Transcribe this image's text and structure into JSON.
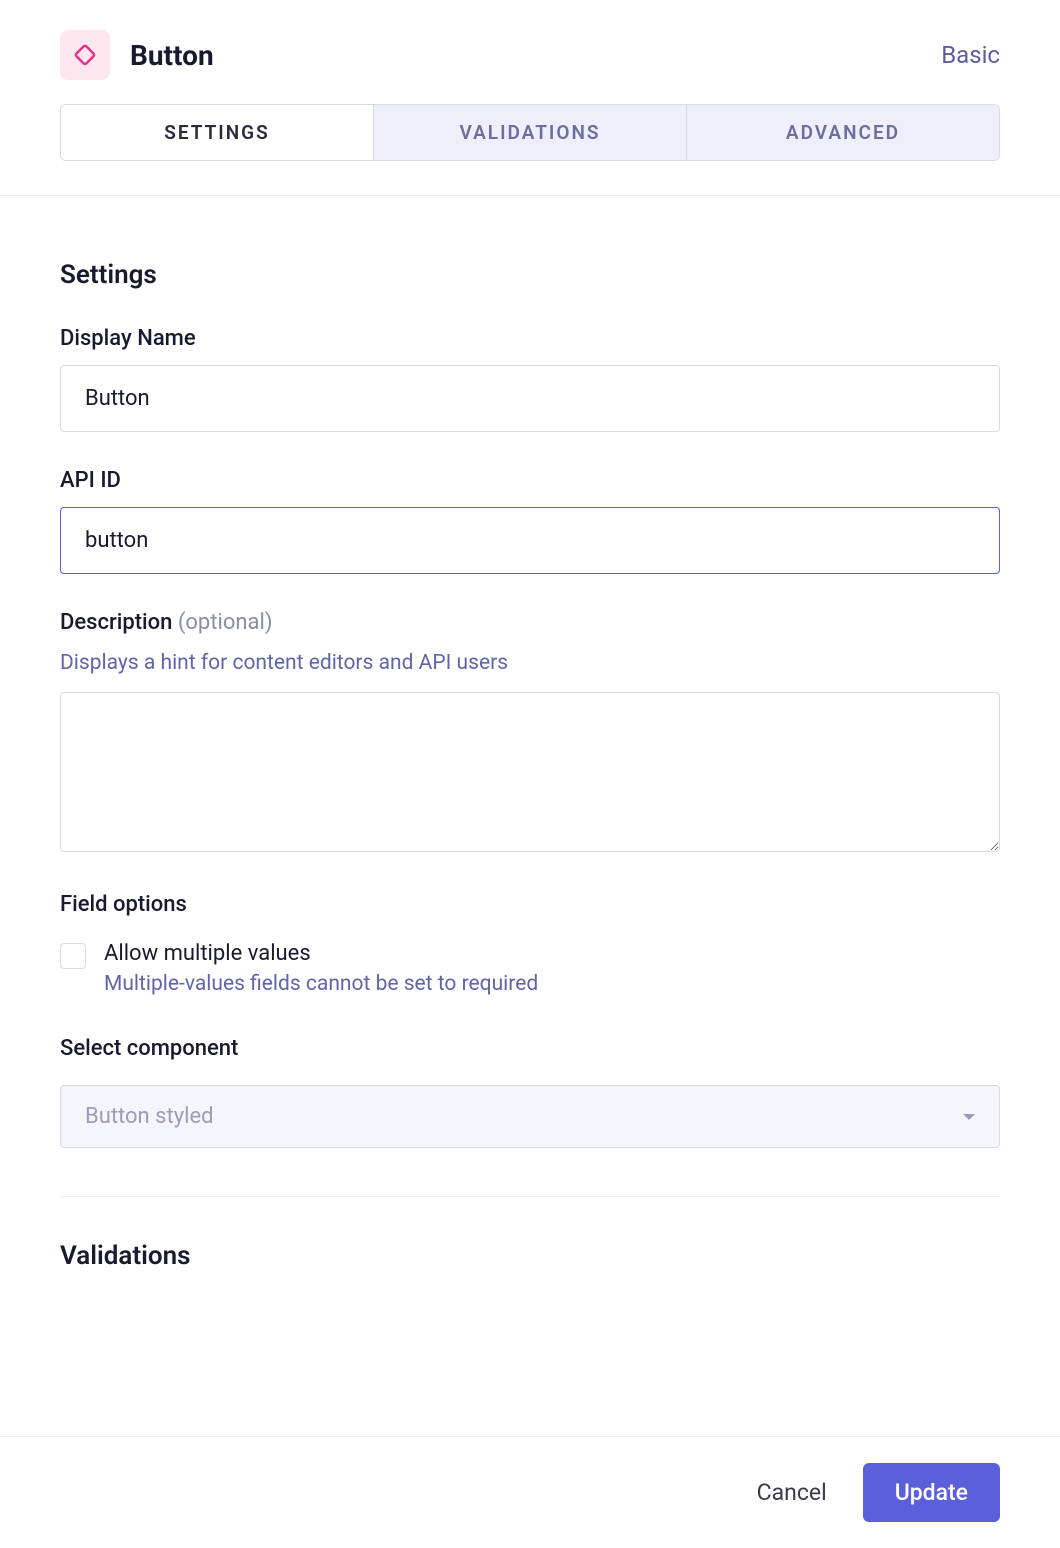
{
  "header": {
    "title": "Button",
    "type_badge": "Basic",
    "icon_name": "component-icon"
  },
  "tabs": [
    {
      "label": "SETTINGS",
      "active": true
    },
    {
      "label": "VALIDATIONS",
      "active": false
    },
    {
      "label": "ADVANCED",
      "active": false
    }
  ],
  "settings": {
    "heading": "Settings",
    "display_name": {
      "label": "Display Name",
      "value": "Button"
    },
    "api_id": {
      "label": "API ID",
      "value": "button"
    },
    "description": {
      "label": "Description",
      "optional_suffix": "(optional)",
      "hint": "Displays a hint for content editors and API users",
      "value": ""
    },
    "field_options": {
      "heading": "Field options",
      "allow_multiple": {
        "label": "Allow multiple values",
        "sub": "Multiple-values fields cannot be set to required",
        "checked": false
      }
    },
    "select_component": {
      "label": "Select component",
      "value": "Button styled"
    }
  },
  "validations": {
    "heading": "Validations"
  },
  "footer": {
    "cancel": "Cancel",
    "update": "Update"
  },
  "colors": {
    "accent": "#5b5fd9",
    "icon_bg": "#fde8f0",
    "icon_fg": "#e5338a"
  }
}
